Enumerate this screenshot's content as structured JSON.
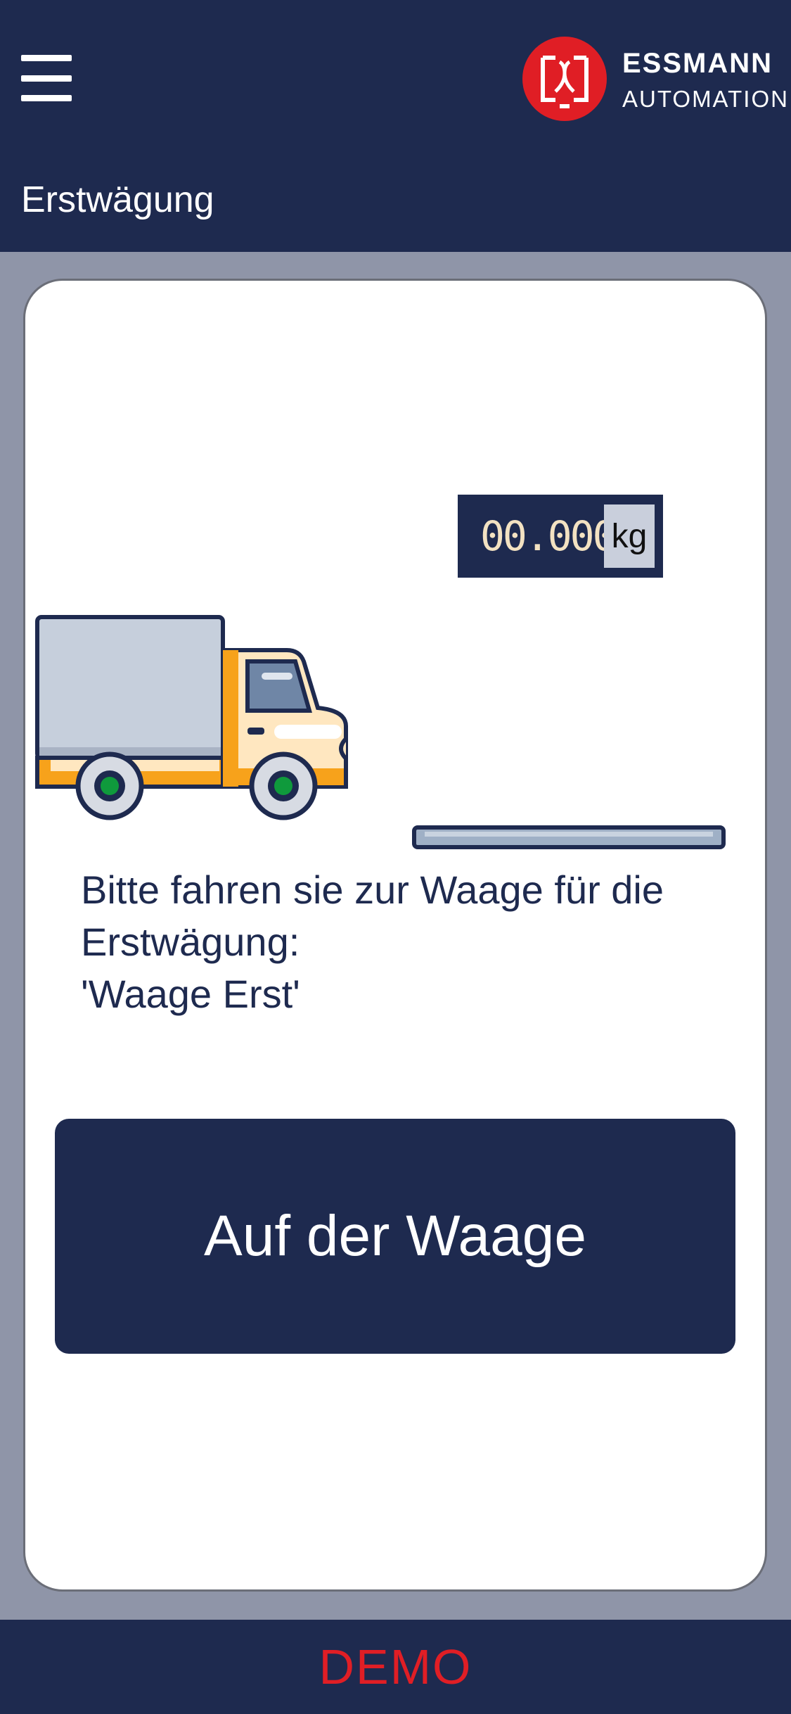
{
  "header": {
    "menu_icon": "hamburger-menu-icon",
    "logo": {
      "icon": "essmann-logo-mark",
      "line1": "ESSMANN",
      "line2": "AUTOMATION",
      "brand_color": "#e01e25"
    },
    "title": "Erstwägung",
    "background_color": "#1e2a4f"
  },
  "scale": {
    "reading": "00.000",
    "unit": "kg"
  },
  "illustration": {
    "truck_icon": "truck-icon",
    "scale_platform_icon": "scale-platform-icon"
  },
  "instruction": {
    "line1": "Bitte fahren sie zur Waage für die",
    "line2": "Erstwägung:",
    "line3": "'Waage Erst'"
  },
  "actions": {
    "on_scale_label": "Auf der Waage"
  },
  "footer": {
    "label": "DEMO",
    "label_color": "#e01e25"
  }
}
